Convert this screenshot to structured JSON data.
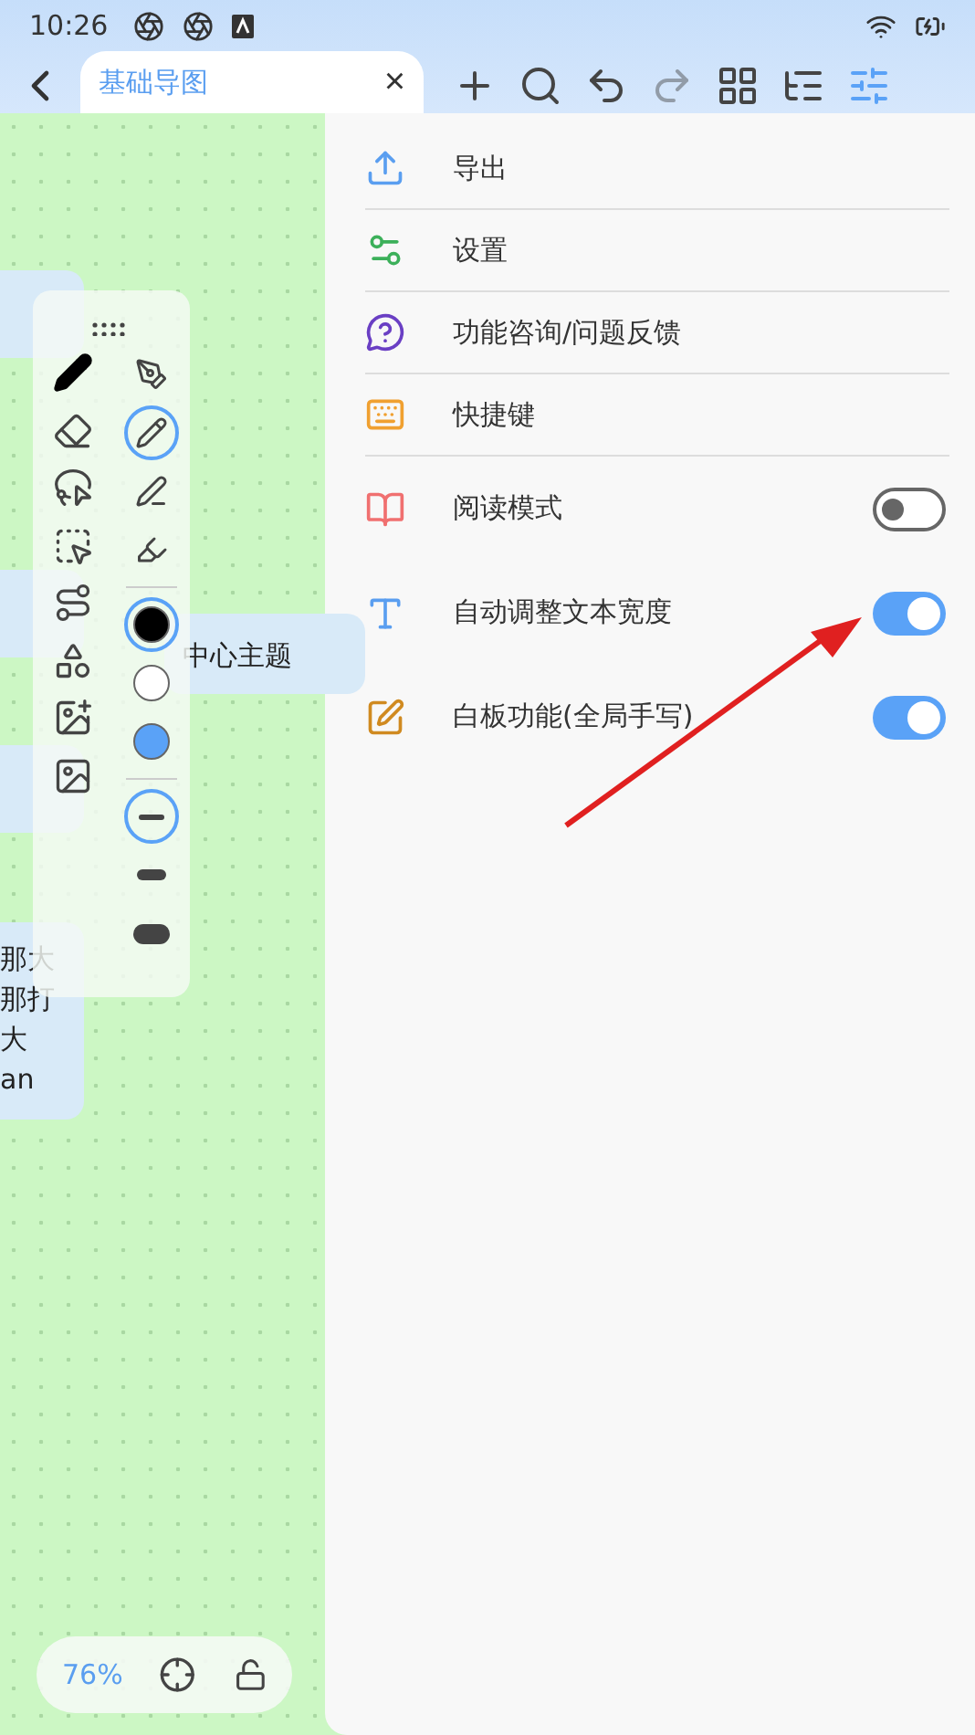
{
  "status_bar": {
    "time": "10:26"
  },
  "tab": {
    "title": "基础导图",
    "close": "×"
  },
  "toolbar_buttons": [
    {
      "kind": "add",
      "disabled": false,
      "selected": false
    },
    {
      "kind": "search",
      "disabled": false,
      "selected": false
    },
    {
      "kind": "undo",
      "disabled": false,
      "selected": false
    },
    {
      "kind": "redo",
      "disabled": true,
      "selected": false
    },
    {
      "kind": "layout",
      "disabled": false,
      "selected": false
    },
    {
      "kind": "outline",
      "disabled": false,
      "selected": false
    },
    {
      "kind": "settings",
      "disabled": false,
      "selected": true
    }
  ],
  "menu": [
    {
      "kind": "action",
      "label": "导出"
    },
    {
      "kind": "action",
      "label": "设置"
    },
    {
      "kind": "action",
      "label": "功能咨询/问题反馈"
    },
    {
      "kind": "action",
      "label": "快捷键"
    },
    {
      "kind": "toggle",
      "label": "阅读模式",
      "on": false
    },
    {
      "kind": "toggle",
      "label": "自动调整文本宽度",
      "on": true
    },
    {
      "kind": "toggle",
      "label": "白板功能(全局手写)",
      "on": true
    }
  ],
  "canvas": {
    "center_topic": "中心主题",
    "side_topic_lines": [
      "那大",
      "那打",
      "大",
      "an"
    ]
  },
  "draw_tools": [
    {
      "selected": true
    },
    {
      "selected": false
    },
    {
      "selected": false
    },
    {
      "selected": false
    },
    {
      "selected": false
    },
    {
      "selected": false
    },
    {
      "selected": false
    },
    {
      "selected": false
    }
  ],
  "pen_types": [
    {
      "selected": false
    },
    {
      "selected": true
    },
    {
      "selected": false
    },
    {
      "selected": false
    }
  ],
  "colors": [
    {
      "color": "#000000",
      "selected": true
    },
    {
      "color": "#ffffff",
      "selected": false
    },
    {
      "color": "#5aa2f7",
      "selected": false
    }
  ],
  "stroke_widths": [
    {
      "selected": true
    },
    {
      "selected": false
    },
    {
      "selected": false
    }
  ],
  "zoom": {
    "level_text": "76%"
  }
}
